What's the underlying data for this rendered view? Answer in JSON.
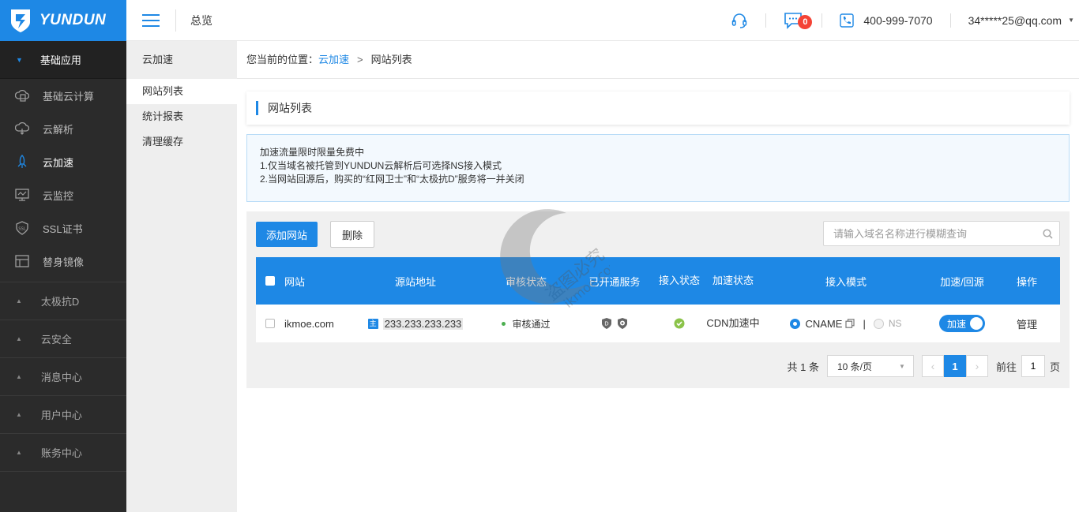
{
  "brand": {
    "name": "YUNDUN"
  },
  "sidebar": {
    "group_title": "基础应用",
    "items": [
      {
        "label": "基础云计算",
        "icon": "cloud-compute-icon",
        "active": false
      },
      {
        "label": "云解析",
        "icon": "cloud-dns-icon",
        "active": false
      },
      {
        "label": "云加速",
        "icon": "rocket-icon",
        "active": true
      },
      {
        "label": "云监控",
        "icon": "monitor-icon",
        "active": false
      },
      {
        "label": "SSL证书",
        "icon": "ssl-icon",
        "active": false
      },
      {
        "label": "替身镜像",
        "icon": "mirror-icon",
        "active": false
      }
    ],
    "collapsed_groups": [
      "太极抗D",
      "云安全",
      "消息中心",
      "用户中心",
      "账务中心"
    ]
  },
  "header": {
    "title": "总览",
    "message_count": "0",
    "phone": "400-999-7070",
    "user": "34*****25@qq.com"
  },
  "subnav": {
    "title": "云加速",
    "items": [
      "网站列表",
      "统计报表",
      "清理缓存"
    ],
    "active_index": 0
  },
  "breadcrumb": {
    "prefix": "您当前的位置：",
    "link": "云加速",
    "separator": ">",
    "current": "网站列表"
  },
  "section_title": "网站列表",
  "notice": {
    "lines": [
      "加速流量限时限量免费中",
      "1.仅当域名被托管到YUNDUN云解析后可选择NS接入模式",
      "2.当网站回源后，购买的“红网卫士”和“太极抗D”服务将一并关闭"
    ]
  },
  "toolbar": {
    "add_label": "添加网站",
    "delete_label": "删除",
    "search_placeholder": "请输入域名名称进行模糊查询"
  },
  "table": {
    "headers": {
      "site": "网站",
      "source": "源站地址",
      "audit": "审核状态",
      "services": "已开通服务",
      "access": "接入状态",
      "accel": "加速状态",
      "mode": "接入模式",
      "back": "加速/回源",
      "op": "操作"
    },
    "rows": [
      {
        "site": "ikmoe.com",
        "source_icon": "主",
        "source": "233.233.233.233",
        "audit": "审核通过",
        "accel": "CDN加速中",
        "mode_on": "CNAME",
        "mode_off": "NS",
        "toggle": "加速",
        "op": "管理"
      }
    ]
  },
  "pagination": {
    "total": "共 1 条",
    "page_size": "10 条/页",
    "current_page": "1",
    "goto_prefix": "前往",
    "goto_value": "1",
    "goto_suffix": "页"
  },
  "watermark": {
    "line1": "盗图必究",
    "line2": "ikmoe.com"
  },
  "colors": {
    "accent": "#1e88e5",
    "sidebar": "#2b2b2b",
    "success": "#8bc34a"
  }
}
